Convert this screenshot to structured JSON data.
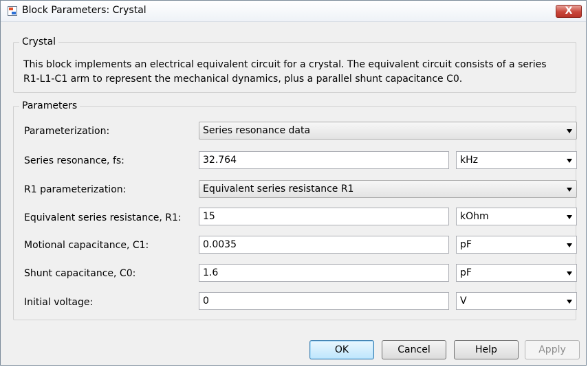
{
  "window": {
    "title": "Block Parameters: Crystal",
    "close_label": "X"
  },
  "description_group": {
    "label": "Crystal",
    "text_line1": "This block implements an electrical equivalent circuit for a crystal. The equivalent circuit consists of a series",
    "text_line2": "R1-L1-C1 arm to represent the mechanical dynamics, plus a parallel shunt capacitance C0."
  },
  "parameters_group": {
    "label": "Parameters",
    "rows": [
      {
        "label": "Parameterization:",
        "value": "Series resonance data"
      },
      {
        "label": "Series resonance, fs:",
        "value": "32.764",
        "unit": "kHz"
      },
      {
        "label": "R1 parameterization:",
        "value": "Equivalent series resistance R1"
      },
      {
        "label": "Equivalent series resistance, R1:",
        "value": "15",
        "unit": "kOhm"
      },
      {
        "label": "Motional capacitance, C1:",
        "value": "0.0035",
        "unit": "pF"
      },
      {
        "label": "Shunt capacitance, C0:",
        "value": "1.6",
        "unit": "pF"
      },
      {
        "label": "Initial voltage:",
        "value": "0",
        "unit": "V"
      }
    ]
  },
  "buttons": {
    "ok": "OK",
    "cancel": "Cancel",
    "help": "Help",
    "apply": "Apply"
  }
}
